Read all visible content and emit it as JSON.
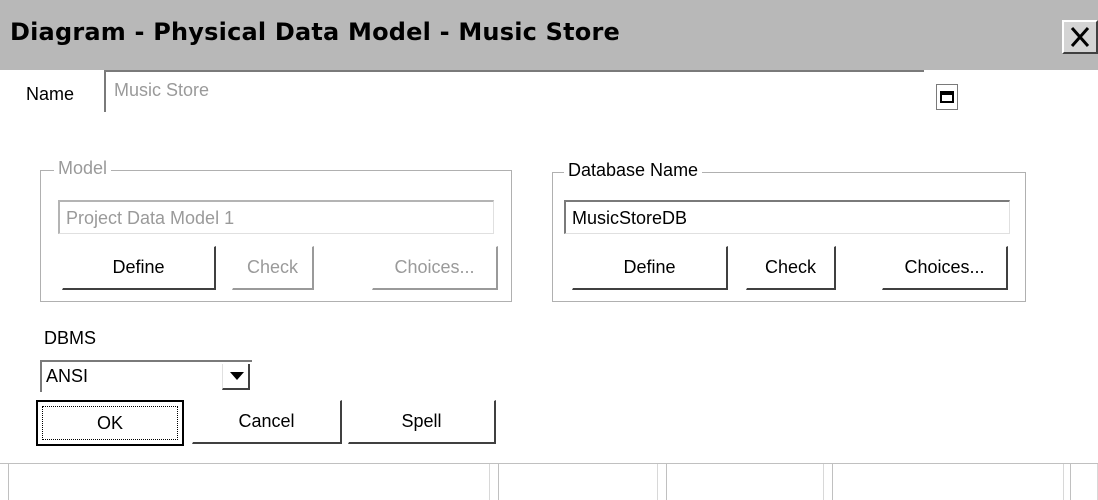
{
  "window": {
    "title": "Diagram - Physical Data Model - Music Store",
    "close_icon": "close-icon"
  },
  "name": {
    "label": "Name",
    "value": "Music Store"
  },
  "model_group": {
    "legend": "Model",
    "value": "Project Data Model 1",
    "define_label": "Define",
    "check_label": "Check",
    "choices_label": "Choices..."
  },
  "database_group": {
    "legend": "Database Name",
    "value": "MusicStoreDB",
    "define_label": "Define",
    "check_label": "Check",
    "choices_label": "Choices..."
  },
  "dbms": {
    "label": "DBMS",
    "selected": "ANSI"
  },
  "buttons": {
    "ok_label": "OK",
    "cancel_label": "Cancel",
    "spell_label": "Spell"
  },
  "colors": {
    "titlebar": "#b8b8b8",
    "disabled_text": "#9a9a9a"
  }
}
